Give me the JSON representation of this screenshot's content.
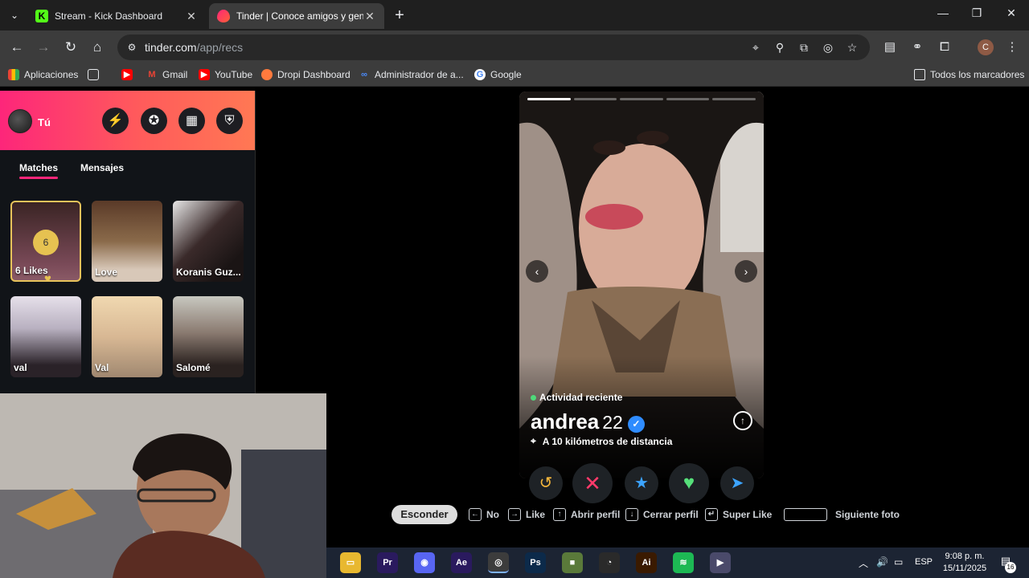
{
  "browser": {
    "tab_menu_icon": "chevron-down-icon",
    "tabs": [
      {
        "title": "Stream - Kick Dashboard",
        "favicon": "kick-icon",
        "favicon_letter": "K",
        "active": false
      },
      {
        "title": "Tinder | Conoce amigos y gente",
        "favicon": "tinder-flame-icon",
        "active": true
      }
    ],
    "close_glyph": "✕",
    "new_tab_glyph": "+",
    "window_controls": {
      "minimize": "—",
      "restore": "❐",
      "close": "✕"
    },
    "nav": {
      "back": "←",
      "forward": "→",
      "reload": "↻",
      "home": "⌂"
    },
    "omnibox": {
      "site_info_glyph": "⚙",
      "url_host": "tinder.com",
      "url_path": "/app/recs",
      "icons": {
        "location": "⌖",
        "zoom": "⚲",
        "install": "⧉",
        "eye_off": "◎",
        "bookmark_star": "☆"
      }
    },
    "toolbar_icons": {
      "reading_list": "▤",
      "extension_link": "⚭",
      "extensions": "⧠",
      "menu": "⋮"
    },
    "profile_letter": "C",
    "bookmarks": {
      "apps_label": "Aplicaciones",
      "items": [
        {
          "label": "",
          "icon": "youtube-icon"
        },
        {
          "label": "Gmail",
          "icon": "gmail-icon"
        },
        {
          "label": "YouTube",
          "icon": "youtube-icon"
        },
        {
          "label": "Dropi Dashboard",
          "icon": "dropi-icon"
        },
        {
          "label": "Administrador de a...",
          "icon": "meta-icon"
        },
        {
          "label": "Google",
          "icon": "google-icon"
        }
      ],
      "all_bookmarks": "Todos los marcadores"
    }
  },
  "sidebar": {
    "me_label": "Tú",
    "head_buttons": [
      {
        "name": "boost-button",
        "glyph": "⚡"
      },
      {
        "name": "explore-button",
        "glyph": "✪"
      },
      {
        "name": "work-mode-button",
        "glyph": "▦"
      },
      {
        "name": "safety-button",
        "glyph": "⛨"
      }
    ],
    "tabs": {
      "matches": "Matches",
      "messages": "Mensajes"
    },
    "likes": {
      "count": "6",
      "label": "6 Likes"
    },
    "matches": [
      {
        "name": "Love"
      },
      {
        "name": "Koranis Guz..."
      },
      {
        "name": "val"
      },
      {
        "name": "Val"
      },
      {
        "name": "Salomé"
      }
    ]
  },
  "profile": {
    "photo_count": 5,
    "current_photo": 1,
    "activity": "Actividad reciente",
    "name": "andrea",
    "age": "22",
    "distance": "A 10 kilómetros de distancia",
    "prev_glyph": "‹",
    "next_glyph": "›",
    "up_glyph": "↑",
    "verified_glyph": "✓"
  },
  "actions": {
    "rewind": "↺",
    "nope": "✕",
    "super_like": "★",
    "like": "♥",
    "boost": "➤"
  },
  "shortcuts": {
    "hide": "Esconder",
    "items": [
      {
        "key": "←",
        "label": "No"
      },
      {
        "key": "→",
        "label": "Like"
      },
      {
        "key": "↑",
        "label": "Abrir perfil"
      },
      {
        "key": "↓",
        "label": "Cerrar perfil"
      },
      {
        "key": "↵",
        "label": "Super Like"
      },
      {
        "key": "",
        "label": "Siguiente foto"
      }
    ]
  },
  "taskbar": {
    "apps": [
      {
        "name": "file-explorer",
        "label": "▭",
        "color": "#e8b830"
      },
      {
        "name": "premiere-pro",
        "label": "Pr",
        "color": "#2a1a5e"
      },
      {
        "name": "discord",
        "label": "◉",
        "color": "#5865f2"
      },
      {
        "name": "after-effects",
        "label": "Ae",
        "color": "#2a1a5e"
      },
      {
        "name": "chrome",
        "label": "◎",
        "color": "#3c3c3c"
      },
      {
        "name": "photoshop",
        "label": "Ps",
        "color": "#0c2a4a"
      },
      {
        "name": "minecraft",
        "label": "■",
        "color": "#5a7a3a"
      },
      {
        "name": "obs",
        "label": "◔",
        "color": "#2a2a2a"
      },
      {
        "name": "illustrator",
        "label": "Ai",
        "color": "#3a1a00"
      },
      {
        "name": "spotify",
        "label": "≋",
        "color": "#1db954"
      },
      {
        "name": "media-player",
        "label": "▶",
        "color": "#4a4a6a"
      }
    ],
    "tray": {
      "chevron": "︿",
      "volume": "🔊",
      "network": "▭",
      "lang": "ESP"
    },
    "time": "9:08 p. m.",
    "date": "15/11/2025",
    "notifications": "16",
    "notif_glyph": "▤"
  }
}
